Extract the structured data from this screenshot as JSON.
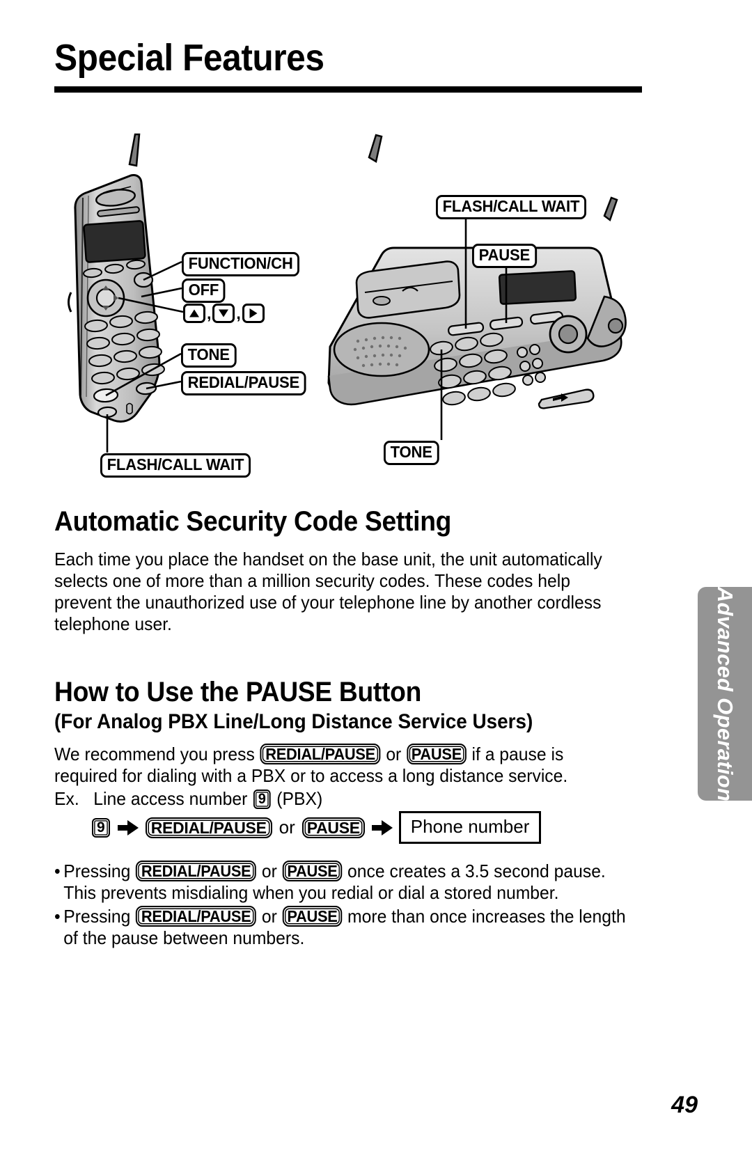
{
  "header": {
    "title": "Special Features"
  },
  "figure": {
    "handset_labels": [
      {
        "text": "FUNCTION/CH"
      },
      {
        "text": "OFF"
      },
      {
        "text": "TONE"
      },
      {
        "text": "REDIAL/PAUSE"
      },
      {
        "text": "FLASH/CALL WAIT"
      }
    ],
    "nav_keys": {
      "separator": ",",
      "up_icon": "triangle-up-icon",
      "down_icon": "triangle-down-icon",
      "right_icon": "triangle-right-icon"
    },
    "base_labels": [
      {
        "text": "FLASH/CALL WAIT"
      },
      {
        "text": "PAUSE"
      },
      {
        "text": "TONE"
      }
    ]
  },
  "section1": {
    "heading": "Automatic Security Code Setting",
    "paragraph": "Each time you place the handset on the base unit, the unit automatically selects one of more than a million security codes. These codes help prevent the unauthorized use of your telephone line by another cordless telephone user."
  },
  "section2": {
    "heading": "How to Use the PAUSE Button",
    "subheading": "(For Analog PBX Line/Long Distance Service Users)",
    "para_part1": "We recommend you press",
    "key_redial_pause": "REDIAL/PAUSE",
    "or": "or",
    "key_pause": "PAUSE",
    "para_part2": "if a pause is required for dialing with a PBX or to access a long distance service.",
    "example_prefix": "Ex.",
    "example_text1": "Line access number",
    "key_nine": "9",
    "example_text2": "(PBX)",
    "flow": {
      "step1": "9",
      "step2": "REDIAL/PAUSE",
      "or": "or",
      "step3": "PAUSE",
      "step4": "Phone number",
      "arrow_icon": "arrow-right-icon"
    },
    "bullets": [
      {
        "marker": "•",
        "text_before": "Pressing",
        "key1": "REDIAL/PAUSE",
        "or": "or",
        "key2": "PAUSE",
        "text_after": "once creates a 3.5 second pause. This prevents misdialing when you redial or dial a stored number."
      },
      {
        "marker": "•",
        "text_before": "Pressing",
        "key1": "REDIAL/PAUSE",
        "or": "or",
        "key2": "PAUSE",
        "text_after": "more than once increases the length of the pause between numbers."
      }
    ]
  },
  "side_tab": {
    "label": "Advanced Operation",
    "color": "#949494"
  },
  "footer": {
    "page_number": "49"
  }
}
